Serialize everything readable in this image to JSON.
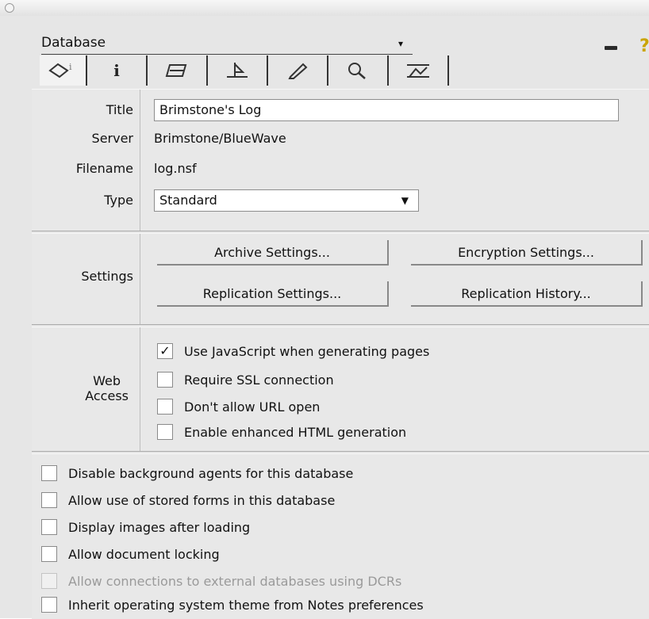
{
  "window": {
    "button_label": "○"
  },
  "header": {
    "selector_label": "Database",
    "selector_arrow": "▾",
    "help_glyph": "?"
  },
  "tabs": [
    {
      "icon": "info-tab-icon",
      "glyph": "◇ⁱ"
    },
    {
      "icon": "info-icon",
      "glyph": "i"
    },
    {
      "icon": "printer-icon",
      "glyph": ""
    },
    {
      "icon": "design-icon",
      "glyph": ""
    },
    {
      "icon": "pencil-icon",
      "glyph": ""
    },
    {
      "icon": "search-icon",
      "glyph": ""
    },
    {
      "icon": "advanced-icon",
      "glyph": ""
    }
  ],
  "basics": {
    "title_label": "Title",
    "title_value": "Brimstone's Log",
    "server_label": "Server",
    "server_value": "Brimstone/BlueWave",
    "filename_label": "Filename",
    "filename_value": "log.nsf",
    "type_label": "Type",
    "type_value": "Standard"
  },
  "settings": {
    "label": "Settings",
    "archive": "Archive Settings...",
    "encryption": "Encryption Settings...",
    "replication": "Replication Settings...",
    "history": "Replication History..."
  },
  "web_access": {
    "label_line1": "Web",
    "label_line2": "Access",
    "options": [
      {
        "label": "Use JavaScript when generating pages",
        "checked": true
      },
      {
        "label": "Require SSL connection",
        "checked": false
      },
      {
        "label": "Don't allow URL open",
        "checked": false
      },
      {
        "label": "Enable enhanced HTML generation",
        "checked": false
      }
    ]
  },
  "general": {
    "options": [
      {
        "label": "Disable background agents for this database",
        "checked": false,
        "disabled": false
      },
      {
        "label": "Allow use of stored forms in this database",
        "checked": false,
        "disabled": false
      },
      {
        "label": "Display images after loading",
        "checked": false,
        "disabled": false
      },
      {
        "label": "Allow document locking",
        "checked": false,
        "disabled": false
      },
      {
        "label": "Allow connections to external databases using DCRs",
        "checked": false,
        "disabled": true
      },
      {
        "label": "Inherit operating system theme from Notes preferences",
        "checked": false,
        "disabled": false
      }
    ]
  },
  "check_glyph": "✓"
}
